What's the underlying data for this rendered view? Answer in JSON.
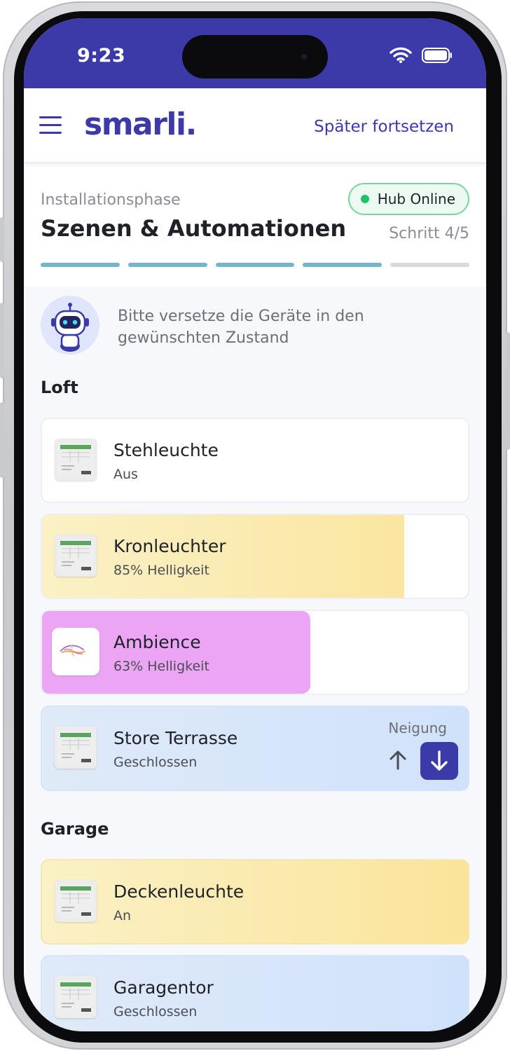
{
  "status_bar": {
    "time": "9:23"
  },
  "header": {
    "logo": "smarli.",
    "later_link": "Später fortsetzen"
  },
  "phase": {
    "label": "Installationsphase",
    "title": "Szenen & Automationen",
    "hub_status": "Hub Online",
    "step": "Schritt 4/5",
    "progress_completed": 4,
    "progress_total": 5
  },
  "instruction": "Bitte versetze die Geräte in den gewünschten Zustand",
  "sections": [
    {
      "title": "Loft",
      "devices": [
        {
          "name": "Stehleuchte",
          "state": "Aus",
          "level": 0
        },
        {
          "name": "Kronleuchter",
          "state": "85% Helligkeit",
          "level": 85
        },
        {
          "name": "Ambience",
          "state": "63% Helligkeit",
          "level": 63
        },
        {
          "name": "Store Terrasse",
          "state": "Geschlossen",
          "control_label": "Neigung"
        }
      ]
    },
    {
      "title": "Garage",
      "devices": [
        {
          "name": "Deckenleuchte",
          "state": "An"
        },
        {
          "name": "Garagentor",
          "state": "Geschlossen"
        }
      ]
    }
  ],
  "colors": {
    "brand": "#3b3aa8",
    "online": "#22c266",
    "progress_done": "#75b4cf",
    "light_on": "#fae6a0",
    "ambience": "#eca4f4",
    "shade": "#d0e2fb"
  },
  "icons": {
    "menu": "hamburger-menu-icon",
    "wifi": "wifi-icon",
    "battery": "battery-icon",
    "assistant": "robot-icon",
    "tilt_up": "arrow-up-icon",
    "tilt_down": "arrow-down-icon"
  }
}
